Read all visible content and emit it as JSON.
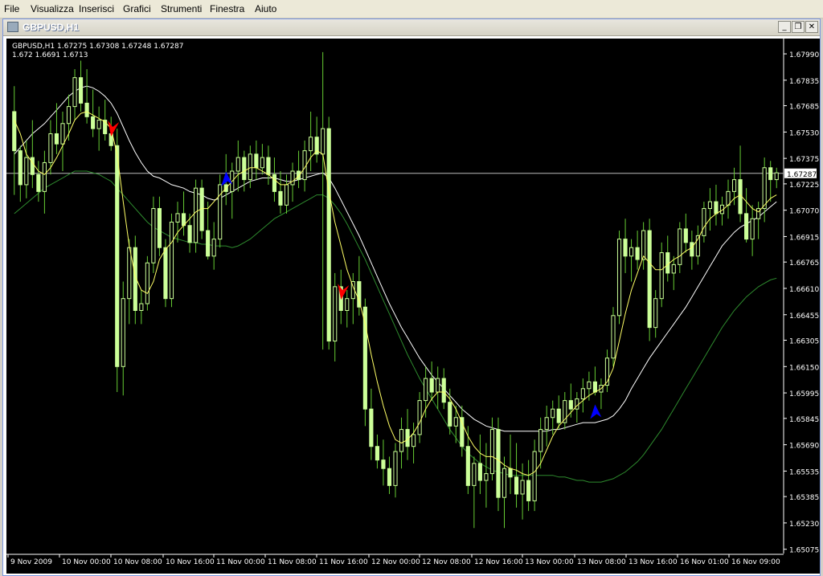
{
  "menubar": {
    "items": [
      {
        "label": "File",
        "u": "F",
        "rest": "ile"
      },
      {
        "label": "Visualizza",
        "u": "V",
        "rest": "isualizza"
      },
      {
        "label": "Inserisci",
        "u": "I",
        "rest": "nserisci"
      },
      {
        "label": "Grafici",
        "u": "G",
        "rest": "rafici"
      },
      {
        "label": "Strumenti",
        "u": "S",
        "rest": "trumenti"
      },
      {
        "label": "Finestra",
        "u": "F",
        "rest": "inestra"
      },
      {
        "label": "Aiuto",
        "u": "A",
        "rest": "iuto"
      }
    ]
  },
  "window": {
    "title": "GBPUSD,H1",
    "buttons": {
      "minimize": "_",
      "restore": "❐",
      "close": "✕"
    }
  },
  "chart": {
    "info_line1": "GBPUSD,H1  1.67275 1.67308 1.67248 1.67287",
    "info_line2": "1.672 1.6691 1.6713",
    "current_price_label": "1.67287"
  },
  "colors": {
    "background": "#000000",
    "candle": "#ccff99",
    "wick": "#66cc33",
    "ma_fast": "#ffff66",
    "ma_mid": "#ffffff",
    "ma_slow": "#2e8b2e",
    "arrow_down": "#ff0000",
    "arrow_up": "#0000ff",
    "axis": "#ffffff"
  },
  "chart_data": {
    "type": "candlestick",
    "symbol": "GBPUSD",
    "timeframe": "H1",
    "ylim": [
      1.6505,
      1.6808
    ],
    "y_ticks": [
      "1.67990",
      "1.67835",
      "1.67685",
      "1.67530",
      "1.67375",
      "1.67225",
      "1.67070",
      "1.66915",
      "1.66765",
      "1.66610",
      "1.66455",
      "1.66305",
      "1.66150",
      "1.65995",
      "1.65845",
      "1.65690",
      "1.65535",
      "1.65385",
      "1.65230",
      "1.65075"
    ],
    "x_ticks": [
      "9 Nov 2009",
      "10 Nov 00:00",
      "10 Nov 08:00",
      "10 Nov 16:00",
      "11 Nov 00:00",
      "11 Nov 08:00",
      "11 Nov 16:00",
      "12 Nov 00:00",
      "12 Nov 08:00",
      "12 Nov 16:00",
      "13 Nov 00:00",
      "13 Nov 08:00",
      "13 Nov 16:00",
      "16 Nov 01:00",
      "16 Nov 09:00"
    ],
    "current_price": 1.67287,
    "candles": [
      [
        1.6765,
        1.678,
        1.6716,
        1.6742
      ],
      [
        1.6742,
        1.6745,
        1.6712,
        1.6722
      ],
      [
        1.6722,
        1.6748,
        1.6714,
        1.6738
      ],
      [
        1.6738,
        1.676,
        1.672,
        1.6728
      ],
      [
        1.6728,
        1.6736,
        1.6712,
        1.6718
      ],
      [
        1.6718,
        1.6742,
        1.6705,
        1.6735
      ],
      [
        1.6735,
        1.676,
        1.6728,
        1.6752
      ],
      [
        1.6752,
        1.677,
        1.674,
        1.6746
      ],
      [
        1.6746,
        1.6765,
        1.673,
        1.6758
      ],
      [
        1.6758,
        1.6775,
        1.6748,
        1.6768
      ],
      [
        1.6768,
        1.679,
        1.676,
        1.6785
      ],
      [
        1.6785,
        1.6795,
        1.6765,
        1.677
      ],
      [
        1.677,
        1.679,
        1.6758,
        1.6762
      ],
      [
        1.6762,
        1.6778,
        1.675,
        1.6755
      ],
      [
        1.6755,
        1.6768,
        1.6742,
        1.676
      ],
      [
        1.676,
        1.6772,
        1.6748,
        1.6752
      ],
      [
        1.6752,
        1.6762,
        1.6742,
        1.6745
      ],
      [
        1.6745,
        1.6755,
        1.66,
        1.6615
      ],
      [
        1.6615,
        1.6665,
        1.6598,
        1.6655
      ],
      [
        1.6655,
        1.669,
        1.664,
        1.6685
      ],
      [
        1.6685,
        1.6692,
        1.664,
        1.6648
      ],
      [
        1.6648,
        1.666,
        1.664,
        1.6652
      ],
      [
        1.6652,
        1.668,
        1.6648,
        1.6676
      ],
      [
        1.6676,
        1.6715,
        1.667,
        1.6708
      ],
      [
        1.6708,
        1.6715,
        1.668,
        1.6685
      ],
      [
        1.6685,
        1.669,
        1.665,
        1.6655
      ],
      [
        1.6655,
        1.6705,
        1.665,
        1.67
      ],
      [
        1.67,
        1.6712,
        1.6688,
        1.6705
      ],
      [
        1.6705,
        1.6718,
        1.6692,
        1.6698
      ],
      [
        1.6698,
        1.6705,
        1.6682,
        1.6688
      ],
      [
        1.6688,
        1.6725,
        1.6682,
        1.672
      ],
      [
        1.672,
        1.6725,
        1.669,
        1.6695
      ],
      [
        1.6695,
        1.6712,
        1.6678,
        1.668
      ],
      [
        1.668,
        1.67,
        1.6672,
        1.669
      ],
      [
        1.669,
        1.6728,
        1.6685,
        1.6722
      ],
      [
        1.6722,
        1.674,
        1.671,
        1.6718
      ],
      [
        1.6718,
        1.6735,
        1.6702,
        1.673
      ],
      [
        1.673,
        1.6748,
        1.6718,
        1.6738
      ],
      [
        1.6738,
        1.6742,
        1.6718,
        1.6725
      ],
      [
        1.6725,
        1.6745,
        1.672,
        1.674
      ],
      [
        1.674,
        1.6748,
        1.6725,
        1.6732
      ],
      [
        1.6732,
        1.6746,
        1.6728,
        1.6738
      ],
      [
        1.6738,
        1.6745,
        1.6722,
        1.6728
      ],
      [
        1.6728,
        1.6738,
        1.6712,
        1.6718
      ],
      [
        1.6718,
        1.673,
        1.6705,
        1.671
      ],
      [
        1.671,
        1.6728,
        1.6705,
        1.6722
      ],
      [
        1.6722,
        1.6735,
        1.6712,
        1.673
      ],
      [
        1.673,
        1.6742,
        1.672,
        1.6725
      ],
      [
        1.6725,
        1.6748,
        1.6718,
        1.6742
      ],
      [
        1.6742,
        1.6765,
        1.673,
        1.675
      ],
      [
        1.675,
        1.6762,
        1.6735,
        1.674
      ],
      [
        1.674,
        1.68,
        1.6625,
        1.6755
      ],
      [
        1.6755,
        1.6762,
        1.6625,
        1.663
      ],
      [
        1.663,
        1.667,
        1.6618,
        1.6662
      ],
      [
        1.6662,
        1.6672,
        1.664,
        1.6648
      ],
      [
        1.6648,
        1.666,
        1.6638,
        1.6655
      ],
      [
        1.6655,
        1.667,
        1.664,
        1.6665
      ],
      [
        1.6665,
        1.668,
        1.6645,
        1.665
      ],
      [
        1.665,
        1.6655,
        1.658,
        1.659
      ],
      [
        1.659,
        1.6602,
        1.656,
        1.6568
      ],
      [
        1.6568,
        1.6575,
        1.6555,
        1.656
      ],
      [
        1.656,
        1.6572,
        1.6545,
        1.6555
      ],
      [
        1.6555,
        1.6562,
        1.654,
        1.6545
      ],
      [
        1.6545,
        1.657,
        1.6538,
        1.6565
      ],
      [
        1.6565,
        1.6585,
        1.6555,
        1.6578
      ],
      [
        1.6578,
        1.659,
        1.656,
        1.6568
      ],
      [
        1.6568,
        1.6582,
        1.6558,
        1.6575
      ],
      [
        1.6575,
        1.66,
        1.657,
        1.6595
      ],
      [
        1.6595,
        1.6615,
        1.6585,
        1.6608
      ],
      [
        1.6608,
        1.6618,
        1.6595,
        1.66
      ],
      [
        1.66,
        1.6615,
        1.659,
        1.6608
      ],
      [
        1.6608,
        1.6614,
        1.659,
        1.6594
      ],
      [
        1.6594,
        1.6602,
        1.6575,
        1.658
      ],
      [
        1.658,
        1.6592,
        1.657,
        1.6585
      ],
      [
        1.6585,
        1.6592,
        1.6562,
        1.6568
      ],
      [
        1.6568,
        1.658,
        1.654,
        1.6545
      ],
      [
        1.6545,
        1.6562,
        1.652,
        1.6558
      ],
      [
        1.6558,
        1.6575,
        1.654,
        1.6548
      ],
      [
        1.6548,
        1.657,
        1.6532,
        1.6552
      ],
      [
        1.6552,
        1.6585,
        1.6548,
        1.6578
      ],
      [
        1.6578,
        1.6585,
        1.653,
        1.6538
      ],
      [
        1.6538,
        1.6562,
        1.652,
        1.6555
      ],
      [
        1.6555,
        1.6575,
        1.654,
        1.655
      ],
      [
        1.655,
        1.657,
        1.6532,
        1.654
      ],
      [
        1.654,
        1.6558,
        1.6525,
        1.6548
      ],
      [
        1.6548,
        1.656,
        1.653,
        1.6536
      ],
      [
        1.6536,
        1.6572,
        1.653,
        1.6565
      ],
      [
        1.6565,
        1.6585,
        1.6555,
        1.6578
      ],
      [
        1.6578,
        1.6592,
        1.6568,
        1.6585
      ],
      [
        1.6585,
        1.6595,
        1.6575,
        1.659
      ],
      [
        1.659,
        1.6598,
        1.6578,
        1.6582
      ],
      [
        1.6582,
        1.66,
        1.6578,
        1.6595
      ],
      [
        1.6595,
        1.6605,
        1.6585,
        1.659
      ],
      [
        1.659,
        1.66,
        1.6582,
        1.6596
      ],
      [
        1.6596,
        1.6608,
        1.6588,
        1.6602
      ],
      [
        1.6602,
        1.6612,
        1.6595,
        1.6606
      ],
      [
        1.6606,
        1.6615,
        1.6598,
        1.66
      ],
      [
        1.66,
        1.6608,
        1.659,
        1.6604
      ],
      [
        1.6604,
        1.6625,
        1.66,
        1.662
      ],
      [
        1.662,
        1.665,
        1.6615,
        1.6645
      ],
      [
        1.6645,
        1.6695,
        1.664,
        1.669
      ],
      [
        1.669,
        1.6702,
        1.667,
        1.668
      ],
      [
        1.668,
        1.669,
        1.6665,
        1.6685
      ],
      [
        1.6685,
        1.6695,
        1.6672,
        1.6678
      ],
      [
        1.6678,
        1.67,
        1.6672,
        1.6695
      ],
      [
        1.6695,
        1.6702,
        1.663,
        1.6638
      ],
      [
        1.6638,
        1.666,
        1.6632,
        1.6655
      ],
      [
        1.6655,
        1.6688,
        1.665,
        1.6682
      ],
      [
        1.6682,
        1.6692,
        1.6665,
        1.667
      ],
      [
        1.667,
        1.668,
        1.666,
        1.6675
      ],
      [
        1.6675,
        1.67,
        1.667,
        1.6696
      ],
      [
        1.6696,
        1.6705,
        1.6682,
        1.6688
      ],
      [
        1.6688,
        1.6695,
        1.6672,
        1.668
      ],
      [
        1.668,
        1.6698,
        1.6675,
        1.6692
      ],
      [
        1.6692,
        1.6712,
        1.6688,
        1.6708
      ],
      [
        1.6708,
        1.672,
        1.6695,
        1.6712
      ],
      [
        1.6712,
        1.6722,
        1.6698,
        1.6705
      ],
      [
        1.6705,
        1.6715,
        1.6698,
        1.671
      ],
      [
        1.671,
        1.6725,
        1.6702,
        1.6718
      ],
      [
        1.6718,
        1.6732,
        1.671,
        1.6725
      ],
      [
        1.6725,
        1.6745,
        1.67,
        1.6705
      ],
      [
        1.6705,
        1.672,
        1.6688,
        1.669
      ],
      [
        1.669,
        1.671,
        1.668,
        1.6702
      ],
      [
        1.6702,
        1.6712,
        1.669,
        1.6708
      ],
      [
        1.6708,
        1.6738,
        1.67,
        1.6732
      ],
      [
        1.6732,
        1.6736,
        1.6712,
        1.6725
      ],
      [
        1.6725,
        1.6732,
        1.672,
        1.6729
      ]
    ],
    "ma_fast": [
      1.676,
      1.6752,
      1.674,
      1.6735,
      1.673,
      1.6728,
      1.6732,
      1.6738,
      1.6745,
      1.6752,
      1.676,
      1.6764,
      1.6765,
      1.6763,
      1.6761,
      1.6759,
      1.6755,
      1.674,
      1.6712,
      1.6686,
      1.6668,
      1.666,
      1.6658,
      1.6665,
      1.6678,
      1.6684,
      1.6688,
      1.6694,
      1.6698,
      1.6702,
      1.6706,
      1.6708,
      1.6708,
      1.6712,
      1.6716,
      1.672,
      1.6724,
      1.6728,
      1.673,
      1.6732,
      1.6732,
      1.673,
      1.6728,
      1.6725,
      1.6722,
      1.6722,
      1.6724,
      1.6727,
      1.6732,
      1.6738,
      1.6742,
      1.674,
      1.6718,
      1.67,
      1.6686,
      1.6672,
      1.6662,
      1.6654,
      1.664,
      1.6622,
      1.6606,
      1.6592,
      1.658,
      1.6572,
      1.657,
      1.6572,
      1.6576,
      1.6582,
      1.659,
      1.6596,
      1.66,
      1.66,
      1.6596,
      1.659,
      1.6582,
      1.6574,
      1.6568,
      1.6564,
      1.6562,
      1.6562,
      1.656,
      1.6557,
      1.6555,
      1.6554,
      1.6552,
      1.6551,
      1.6553,
      1.6558,
      1.6566,
      1.6574,
      1.658,
      1.6584,
      1.6588,
      1.6592,
      1.6595,
      1.6598,
      1.66,
      1.6602,
      1.6606,
      1.6614,
      1.663,
      1.6646,
      1.666,
      1.667,
      1.668,
      1.6676,
      1.6672,
      1.6672,
      1.6675,
      1.6678,
      1.668,
      1.6683,
      1.6685,
      1.669,
      1.6697,
      1.6702,
      1.6705,
      1.6707,
      1.671,
      1.6714,
      1.6716,
      1.6712,
      1.6708,
      1.6706,
      1.671,
      1.6714,
      1.6716
    ],
    "ma_mid": [
      1.674,
      1.6744,
      1.6748,
      1.6752,
      1.6755,
      1.6758,
      1.6762,
      1.6766,
      1.677,
      1.6774,
      1.6777,
      1.6779,
      1.678,
      1.6779,
      1.6777,
      1.6774,
      1.677,
      1.6764,
      1.6756,
      1.6748,
      1.6741,
      1.6735,
      1.673,
      1.6727,
      1.6726,
      1.6724,
      1.6722,
      1.6721,
      1.672,
      1.6718,
      1.6717,
      1.6716,
      1.6714,
      1.6713,
      1.6714,
      1.6716,
      1.6718,
      1.672,
      1.6722,
      1.6724,
      1.6725,
      1.6726,
      1.6726,
      1.6726,
      1.6725,
      1.6724,
      1.6724,
      1.6725,
      1.6726,
      1.6727,
      1.6728,
      1.6729,
      1.6726,
      1.672,
      1.6713,
      1.6706,
      1.6699,
      1.6692,
      1.6684,
      1.6676,
      1.6668,
      1.666,
      1.6652,
      1.6645,
      1.6638,
      1.6632,
      1.6626,
      1.662,
      1.6615,
      1.661,
      1.6606,
      1.6602,
      1.6598,
      1.6594,
      1.659,
      1.6587,
      1.6584,
      1.6582,
      1.658,
      1.6579,
      1.6578,
      1.6577,
      1.6577,
      1.6577,
      1.6577,
      1.6577,
      1.6577,
      1.6577,
      1.6577,
      1.6578,
      1.6578,
      1.6579,
      1.658,
      1.6581,
      1.6582,
      1.6582,
      1.6582,
      1.6583,
      1.6584,
      1.6586,
      1.659,
      1.6595,
      1.6602,
      1.6608,
      1.6614,
      1.662,
      1.6625,
      1.663,
      1.6635,
      1.664,
      1.6645,
      1.665,
      1.6656,
      1.6662,
      1.6668,
      1.6674,
      1.668,
      1.6686,
      1.669,
      1.6694,
      1.6697,
      1.6699,
      1.6701,
      1.6703,
      1.6706,
      1.6709,
      1.6712
    ],
    "ma_slow": [
      1.6705,
      1.6708,
      1.6711,
      1.6714,
      1.6717,
      1.672,
      1.6722,
      1.6724,
      1.6726,
      1.6728,
      1.673,
      1.673,
      1.673,
      1.6729,
      1.6728,
      1.6726,
      1.6724,
      1.672,
      1.6716,
      1.6712,
      1.6708,
      1.6704,
      1.67,
      1.6697,
      1.6695,
      1.6693,
      1.6691,
      1.669,
      1.6689,
      1.6688,
      1.6688,
      1.6687,
      1.6687,
      1.6686,
      1.6686,
      1.6686,
      1.6685,
      1.6686,
      1.6688,
      1.669,
      1.6693,
      1.6696,
      1.6699,
      1.6702,
      1.6704,
      1.6706,
      1.6708,
      1.671,
      1.6712,
      1.6714,
      1.6716,
      1.6716,
      1.6714,
      1.671,
      1.6705,
      1.6699,
      1.6692,
      1.6685,
      1.6678,
      1.667,
      1.6662,
      1.6654,
      1.6646,
      1.6638,
      1.663,
      1.6622,
      1.6615,
      1.6608,
      1.6602,
      1.6596,
      1.659,
      1.6584,
      1.6578,
      1.6573,
      1.6568,
      1.6564,
      1.6561,
      1.6558,
      1.6556,
      1.6554,
      1.6553,
      1.6552,
      1.6551,
      1.6551,
      1.6551,
      1.6551,
      1.6551,
      1.6551,
      1.6551,
      1.6551,
      1.655,
      1.655,
      1.6549,
      1.6548,
      1.6548,
      1.6547,
      1.6547,
      1.6547,
      1.6548,
      1.6549,
      1.6551,
      1.6553,
      1.6556,
      1.6559,
      1.6563,
      1.6568,
      1.6573,
      1.6578,
      1.6584,
      1.659,
      1.6596,
      1.6602,
      1.6608,
      1.6614,
      1.662,
      1.6626,
      1.6632,
      1.6638,
      1.6643,
      1.6648,
      1.6652,
      1.6656,
      1.6659,
      1.6662,
      1.6664,
      1.6666,
      1.6667
    ],
    "signals": [
      {
        "type": "sell",
        "index": 16,
        "price": 1.6756
      },
      {
        "type": "buy",
        "index": 35,
        "price": 1.6725
      },
      {
        "type": "sell",
        "index": 54,
        "price": 1.666
      },
      {
        "type": "buy",
        "index": 96,
        "price": 1.6588
      }
    ]
  }
}
